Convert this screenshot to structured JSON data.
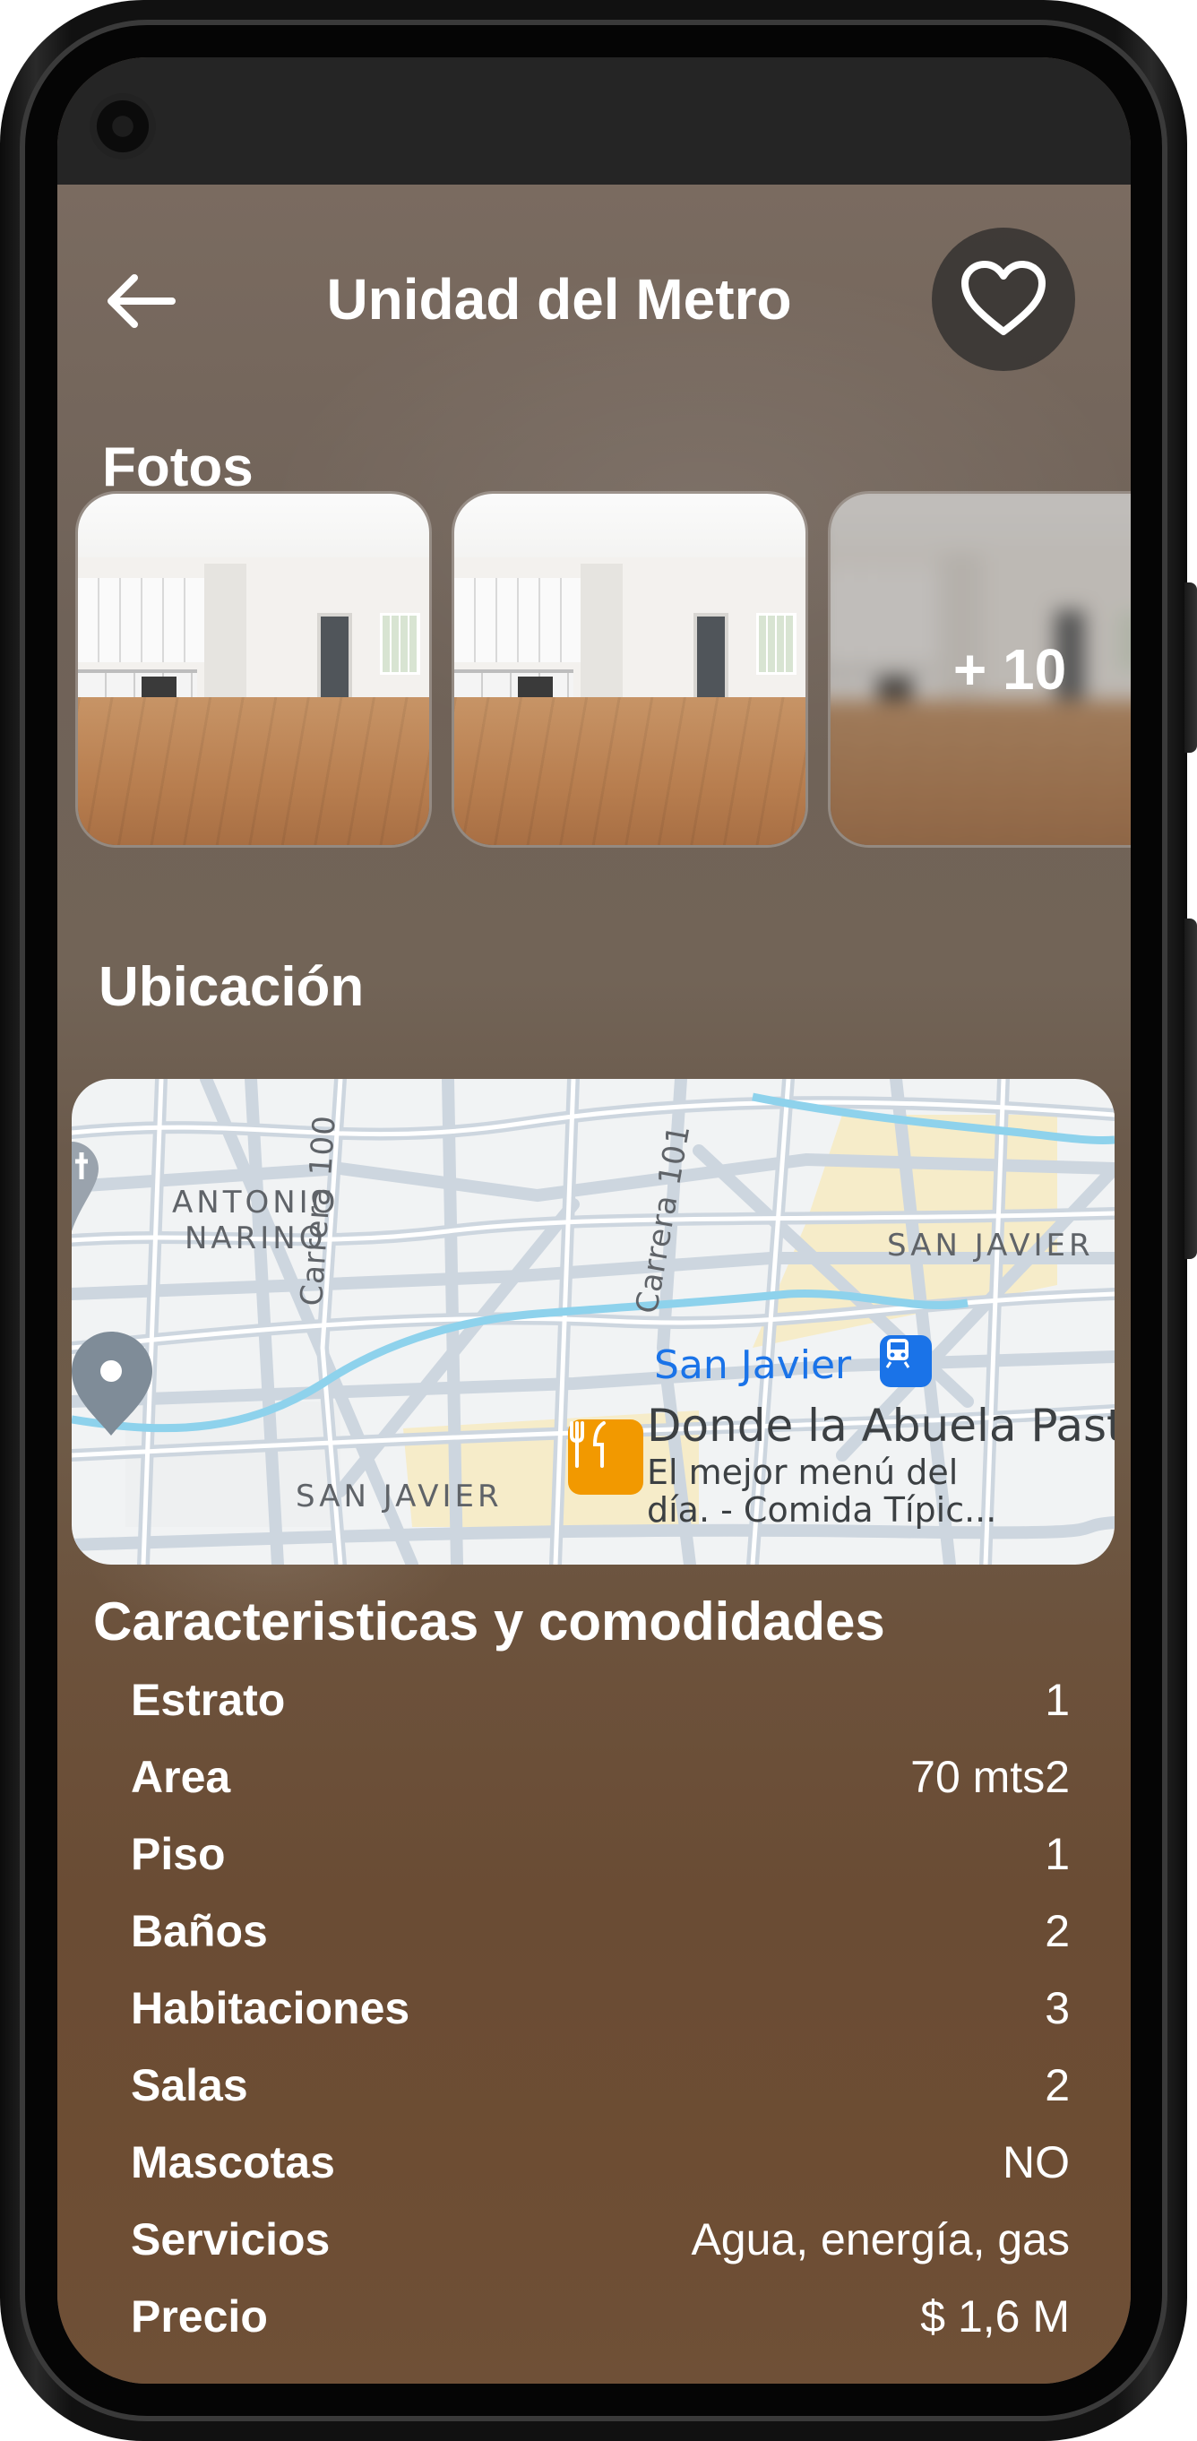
{
  "header": {
    "title": "Unidad del Metro"
  },
  "sections": {
    "photos_title": "Fotos",
    "location_title": "Ubicación",
    "features_title": "Caracteristicas y comodidades"
  },
  "photos": {
    "more_label": "+ 10"
  },
  "map": {
    "labels": {
      "antonio_narino": "ANTONIO\nNARINO",
      "san_javier_1": "SAN JAVIER",
      "san_javier_2": "SAN JAVIER",
      "carrera_100": "Carrera 100",
      "carrera_101": "Carrera 101"
    },
    "metro_station": "San Javier",
    "place_name": "Donde la Abuela Past",
    "place_description_line1": "El mejor menú del",
    "place_description_line2": "día. - Comida Típic..."
  },
  "features": [
    {
      "label": "Estrato",
      "value": "1"
    },
    {
      "label": "Area",
      "value": "70 mts2"
    },
    {
      "label": "Piso",
      "value": "1"
    },
    {
      "label": "Baños",
      "value": "2"
    },
    {
      "label": "Habitaciones",
      "value": "3"
    },
    {
      "label": "Salas",
      "value": "2"
    },
    {
      "label": "Mascotas",
      "value": "NO"
    },
    {
      "label": "Servicios",
      "value": "Agua, energía, gas"
    },
    {
      "label": "Precio",
      "value": "$ 1,6 M"
    }
  ],
  "icons": {
    "back": "arrow-left-icon",
    "favorite": "heart-icon",
    "metro": "train-icon",
    "restaurant": "fork-knife-icon"
  },
  "colors": {
    "status_bar": "#252525",
    "favorite_button_bg": "#3a3a3a",
    "map_water": "#8ed2ec",
    "metro_blue": "#1a73e8",
    "food_orange": "#f29900",
    "text_white": "#ffffff"
  }
}
